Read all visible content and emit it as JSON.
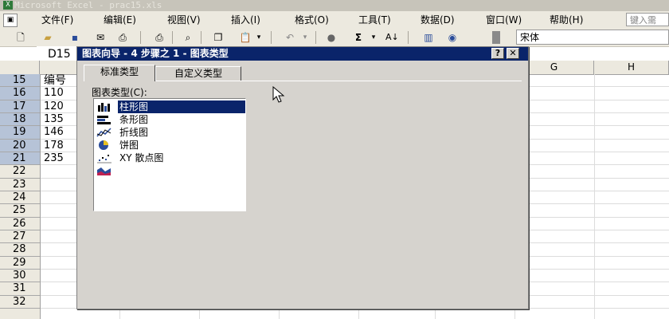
{
  "window": {
    "title": "Microsoft Excel - prac15.xls"
  },
  "menu": {
    "items": [
      "文件(F)",
      "编辑(E)",
      "视图(V)",
      "插入(I)",
      "格式(O)",
      "工具(T)",
      "数据(D)",
      "窗口(W)",
      "帮助(H)"
    ],
    "search_placeholder": "键入需"
  },
  "toolbar": {
    "font_name": "宋体",
    "icons": [
      "new-icon",
      "open-icon",
      "save-icon",
      "permission-icon",
      "print-icon",
      "print-preview-icon",
      "research-icon",
      "copy-icon",
      "paste-icon",
      "undo-icon",
      "hyperlink-icon",
      "autosum-icon",
      "sort-ascending-icon",
      "chart-wizard-icon",
      "help-icon"
    ]
  },
  "sheet": {
    "name_box": "D15",
    "columns": [
      "G",
      "H"
    ],
    "rows": [
      "15",
      "16",
      "17",
      "18",
      "19",
      "20",
      "21",
      "22",
      "23",
      "24",
      "25",
      "26",
      "27",
      "28",
      "29",
      "30",
      "31",
      "32"
    ],
    "cells_col_d": [
      "编号",
      "110",
      "120",
      "135",
      "146",
      "178",
      "235"
    ]
  },
  "dialog": {
    "title": "图表向导 - 4 步骤之 1 - 图表类型",
    "help_label": "?",
    "close_label": "✕",
    "tabs": [
      "标准类型",
      "自定义类型"
    ],
    "chart_types_label": "图表类型(C):",
    "chart_types": [
      "柱形图",
      "条形图",
      "折线图",
      "饼图",
      "XY 散点图",
      ""
    ],
    "selected_index": 0
  },
  "colors": {
    "dialog_title_bg": "#0a246a",
    "selection_bg": "#0a246a",
    "row_header_selected": "#b6c3d7"
  }
}
